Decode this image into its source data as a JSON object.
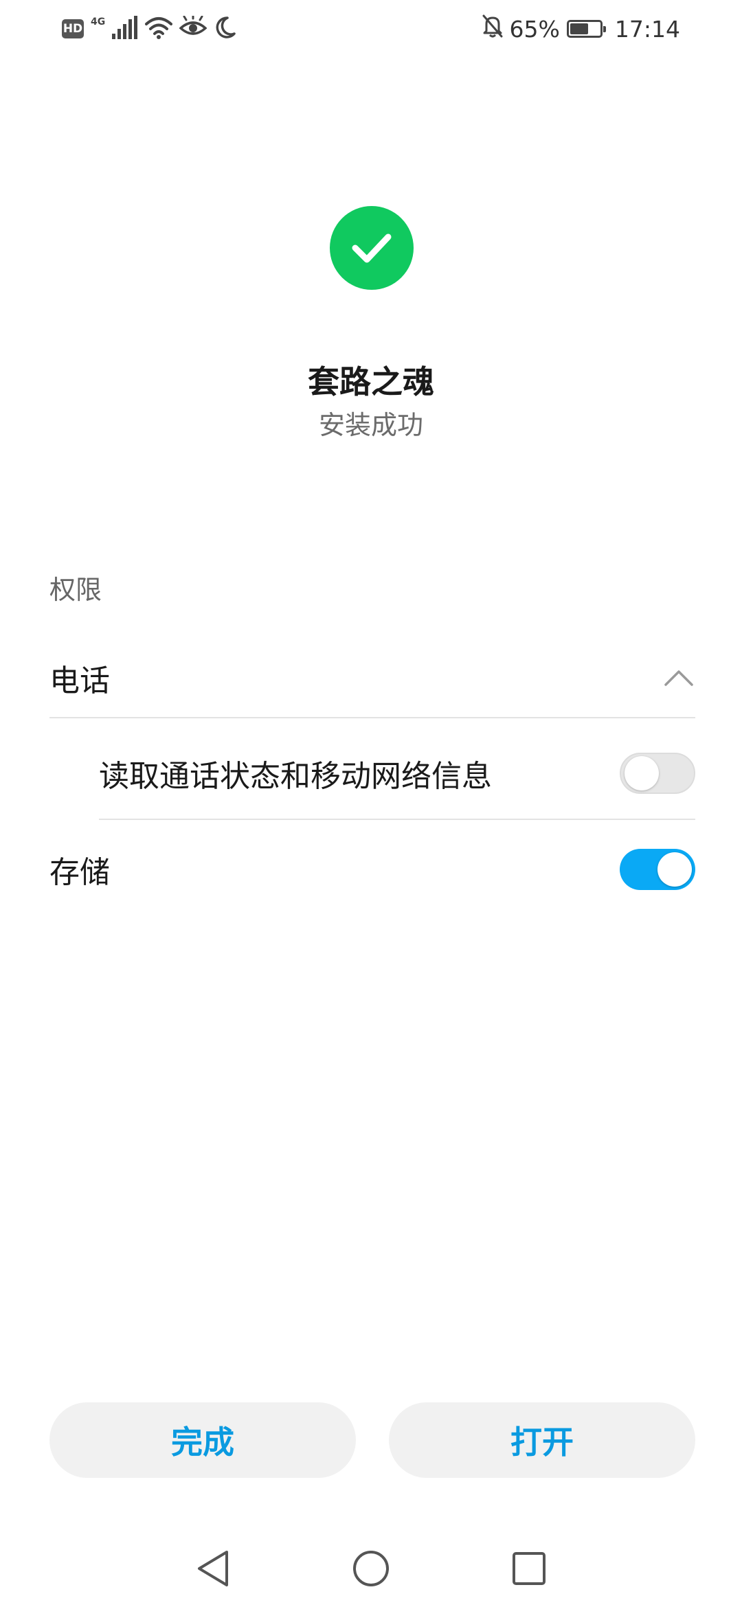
{
  "status_bar": {
    "hd": "HD",
    "network": "4G",
    "battery_percent": "65%",
    "battery_level": 0.65,
    "time": "17:14",
    "icons": [
      "hd-icon",
      "signal-icon",
      "wifi-icon",
      "eye-comfort-icon",
      "moon-icon",
      "bell-off-icon",
      "battery-icon"
    ]
  },
  "app": {
    "name": "套路之魂",
    "status": "安装成功",
    "success_color": "#10c95f"
  },
  "permissions": {
    "section_label": "权限",
    "groups": [
      {
        "label": "电话",
        "expanded": true,
        "items": [
          {
            "label": "读取通话状态和移动网络信息",
            "enabled": false
          }
        ]
      },
      {
        "label": "存储",
        "enabled": true
      }
    ]
  },
  "buttons": {
    "done": "完成",
    "open": "打开",
    "accent_color": "#0a9ae0"
  },
  "nav": {
    "icons": [
      "back-icon",
      "home-icon",
      "recents-icon"
    ]
  }
}
